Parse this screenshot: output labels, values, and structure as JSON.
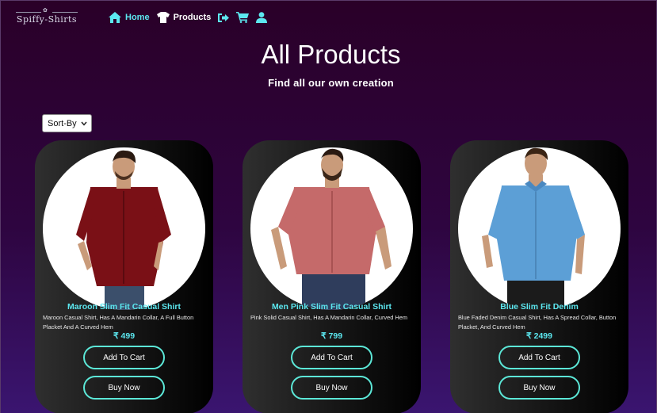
{
  "brand": {
    "name": "Spiffy-Shirts",
    "ornament": "✿"
  },
  "nav": {
    "home_label": "Home",
    "products_label": "Products",
    "icons": [
      "home-icon",
      "tshirt-icon",
      "sign-out-icon",
      "cart-icon",
      "user-icon"
    ]
  },
  "hero": {
    "title": "All Products",
    "subtitle": "Find all our own creation"
  },
  "sort": {
    "selected": "Sort-By"
  },
  "colors": {
    "accent": "#5ce8f0",
    "background_top": "#2a0028",
    "background_bottom": "#3a1570",
    "card_dark": "#000000"
  },
  "products": [
    {
      "title": "Maroon Slim Fit Casual Shirt",
      "description": "Maroon Casual Shirt, Has A Mandarin Collar, A Full Button Placket And A Curved Hem",
      "price": "₹ 499",
      "shirt_color": "#7a1016",
      "add_label": "Add To Cart",
      "buy_label": "Buy Now"
    },
    {
      "title": "Men Pink Slim Fit Casual Shirt",
      "description": "Pink Solid Casual Shirt, Has A Mandarin Collar, Curved Hem",
      "price": "₹ 799",
      "shirt_color": "#c56a6a",
      "add_label": "Add To Cart",
      "buy_label": "Buy Now"
    },
    {
      "title": "Blue Slim Fit Denim",
      "description": "Blue Faded Denim Casual Shirt, Has A Spread Collar, Button Placket, And Curved Hem",
      "price": "₹ 2499",
      "shirt_color": "#5c9fd6",
      "add_label": "Add To Cart",
      "buy_label": "Buy Now"
    }
  ]
}
